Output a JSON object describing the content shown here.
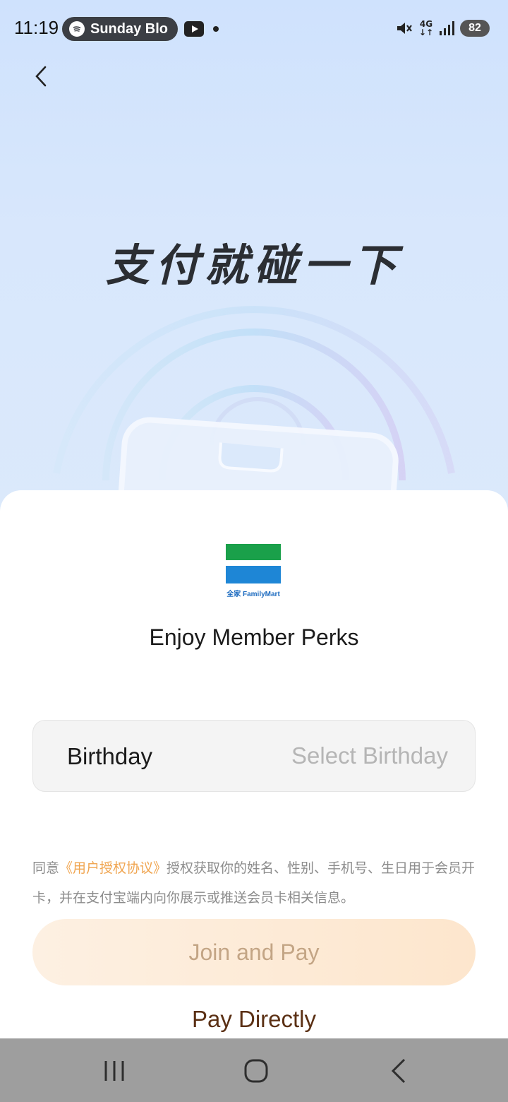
{
  "status_bar": {
    "time": "11:19",
    "media_text": "Sunday Blo",
    "network": "4G",
    "battery": "82"
  },
  "hero": {
    "slogan": "支付就碰一下"
  },
  "merchant": {
    "logo_text": "全家 FamilyMart",
    "title": "Enjoy Member Perks"
  },
  "form": {
    "birthday_label": "Birthday",
    "birthday_placeholder": "Select Birthday"
  },
  "agreement": {
    "prefix": "同意",
    "link": "《用户授权协议》",
    "suffix": "授权获取你的姓名、性别、手机号、生日用于会员开卡，并在支付宝端内向你展示或推送会员卡相关信息。"
  },
  "actions": {
    "join_label": "Join and Pay",
    "pay_direct_label": "Pay Directly"
  },
  "colors": {
    "accent_link": "#f0a550",
    "join_button_text": "#c3a585",
    "pay_direct_text": "#5b3014",
    "logo_green": "#1aa04a",
    "logo_blue": "#1e86d6"
  }
}
